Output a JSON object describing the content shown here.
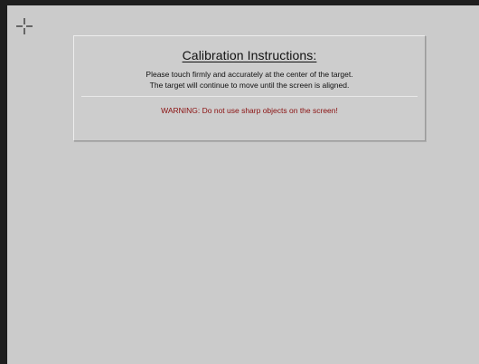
{
  "calibration": {
    "title": "Calibration Instructions:",
    "instruction_line_1": "Please touch firmly and accurately at the center of the target.",
    "instruction_line_2": "The target will continue to move until the screen is aligned.",
    "warning": "WARNING: Do not use sharp objects on the screen!"
  },
  "target": {
    "icon": "crosshair-target-icon"
  },
  "colors": {
    "background": "#cbcbcb",
    "frame": "#1e1e1e",
    "warning_text": "#8a1010"
  }
}
